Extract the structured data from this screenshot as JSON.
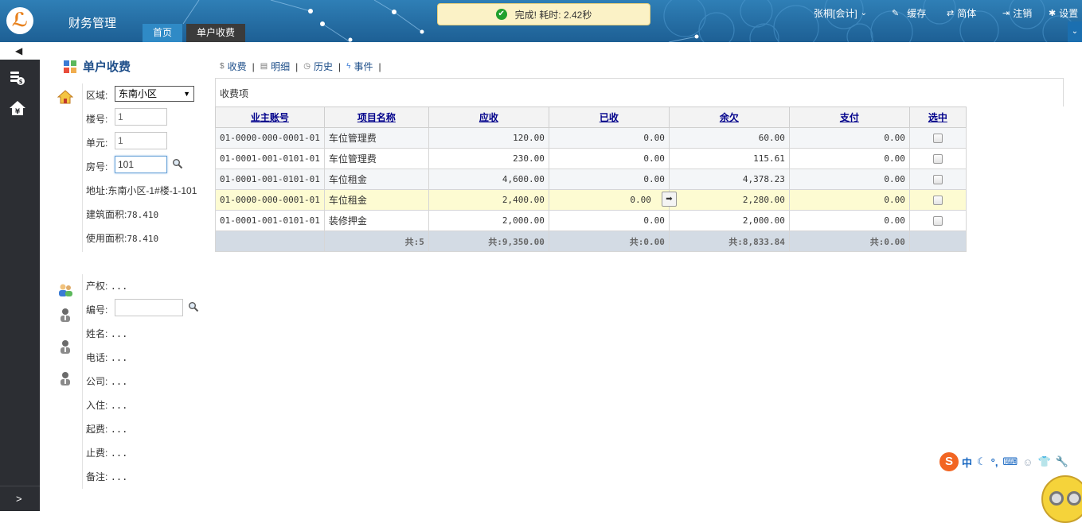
{
  "header": {
    "app_title": "财务管理",
    "tabs": [
      {
        "label": "首页",
        "active": false
      },
      {
        "label": "单户收费",
        "active": true
      }
    ],
    "toast": "完成! 耗时: 2.42秒",
    "user": "张桐[会计]",
    "menu": [
      {
        "label": "缓存",
        "icon": "pencil-icon"
      },
      {
        "label": "简体",
        "icon": "language-icon"
      },
      {
        "label": "注销",
        "icon": "logout-icon"
      },
      {
        "label": "设置",
        "icon": "gear-icon"
      }
    ],
    "colors": {
      "header_bg": "#1d5f94",
      "active_tab": "#3b3b3b",
      "home_tab": "#2f8ac6"
    }
  },
  "sidebar": {
    "collapse_glyph": "◀",
    "expand_glyph": ">",
    "icons": [
      "coins-icon",
      "home-yen-icon"
    ]
  },
  "page": {
    "title": "单户收费",
    "form": {
      "area_label": "区域:",
      "area_value": "东南小区",
      "building_label": "楼号:",
      "building_value": "1",
      "unit_label": "单元:",
      "unit_value": "1",
      "room_label": "房号:",
      "room_value": "101",
      "address_label": "地址:",
      "address_value": "东南小区-1#楼-1-101",
      "built_area_label": "建筑面积:",
      "built_area_value": "78.410",
      "usable_area_label": "使用面积:",
      "usable_area_value": "78.410"
    },
    "owner": {
      "property_label": "产权:",
      "property_value": "...",
      "code_label": "编号:",
      "code_value": "",
      "name_label": "姓名:",
      "name_value": "...",
      "phone_label": "电话:",
      "phone_value": "...",
      "company_label": "公司:",
      "company_value": "...",
      "checkin_label": "入住:",
      "checkin_value": "...",
      "start_fee_label": "起费:",
      "start_fee_value": "...",
      "stop_fee_label": "止费:",
      "stop_fee_value": "...",
      "remark_label": "备注:",
      "remark_value": "..."
    }
  },
  "toolbar": {
    "items": [
      {
        "label": "收费",
        "icon": "dollar-icon"
      },
      {
        "label": "明细",
        "icon": "document-icon"
      },
      {
        "label": "历史",
        "icon": "clock-icon"
      },
      {
        "label": "事件",
        "icon": "lightning-icon"
      }
    ],
    "separator": "|"
  },
  "charges": {
    "group_title": "收费项",
    "columns": [
      "业主账号",
      "项目名称",
      "应收",
      "已收",
      "余欠",
      "支付",
      "选中"
    ],
    "rows": [
      {
        "account": "01-0000-000-0001-01",
        "item": "车位管理费",
        "due": "120.00",
        "paid": "0.00",
        "owed": "60.00",
        "pay": "0.00"
      },
      {
        "account": "01-0001-001-0101-01",
        "item": "车位管理费",
        "due": "230.00",
        "paid": "0.00",
        "owed": "115.61",
        "pay": "0.00"
      },
      {
        "account": "01-0001-001-0101-01",
        "item": "车位租金",
        "due": "4,600.00",
        "paid": "0.00",
        "owed": "4,378.23",
        "pay": "0.00"
      },
      {
        "account": "01-0000-000-0001-01",
        "item": "车位租金",
        "due": "2,400.00",
        "paid": "0.00",
        "owed": "2,280.00",
        "pay": "0.00"
      },
      {
        "account": "01-0001-001-0101-01",
        "item": "装修押金",
        "due": "2,000.00",
        "paid": "0.00",
        "owed": "2,000.00",
        "pay": "0.00"
      }
    ],
    "footer": {
      "count": "共:5",
      "due_total": "共:9,350.00",
      "paid_total": "共:0.00",
      "owed_total": "共:8,833.84",
      "pay_total": "共:0.00"
    },
    "highlight_row_color": "#fdfbd2"
  },
  "ime": {
    "logo": "S",
    "mode": "中",
    "icons": [
      "moon-icon",
      "punctuation-icon",
      "keyboard-icon",
      "user-icon",
      "shirt-icon",
      "wrench-icon"
    ]
  }
}
